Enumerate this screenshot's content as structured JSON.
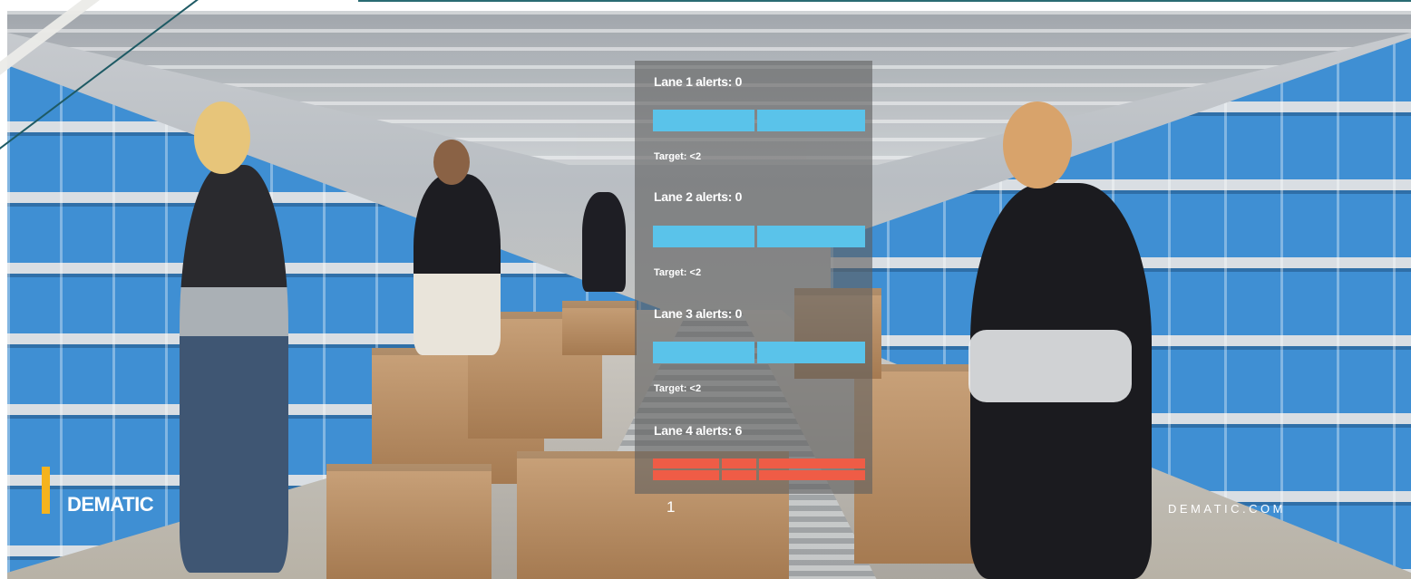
{
  "lanes": [
    {
      "label": "Lane 1 alerts: 0",
      "target": "Target: <2",
      "status": "ok"
    },
    {
      "label": "Lane 2 alerts: 0",
      "target": "Target: <2",
      "status": "ok"
    },
    {
      "label": "Lane 3 alerts: 0",
      "target": "Target: <2",
      "status": "ok"
    },
    {
      "label": "Lane 4 alerts: 6",
      "status": "alert"
    }
  ],
  "footer": {
    "brand": "DEMATIC",
    "page_number": "1",
    "website": "DEMATIC.COM"
  },
  "colors": {
    "ok_bar": "#5ac3ea",
    "alert_bar": "#f05a45",
    "brand_accent": "#f5b31d"
  }
}
